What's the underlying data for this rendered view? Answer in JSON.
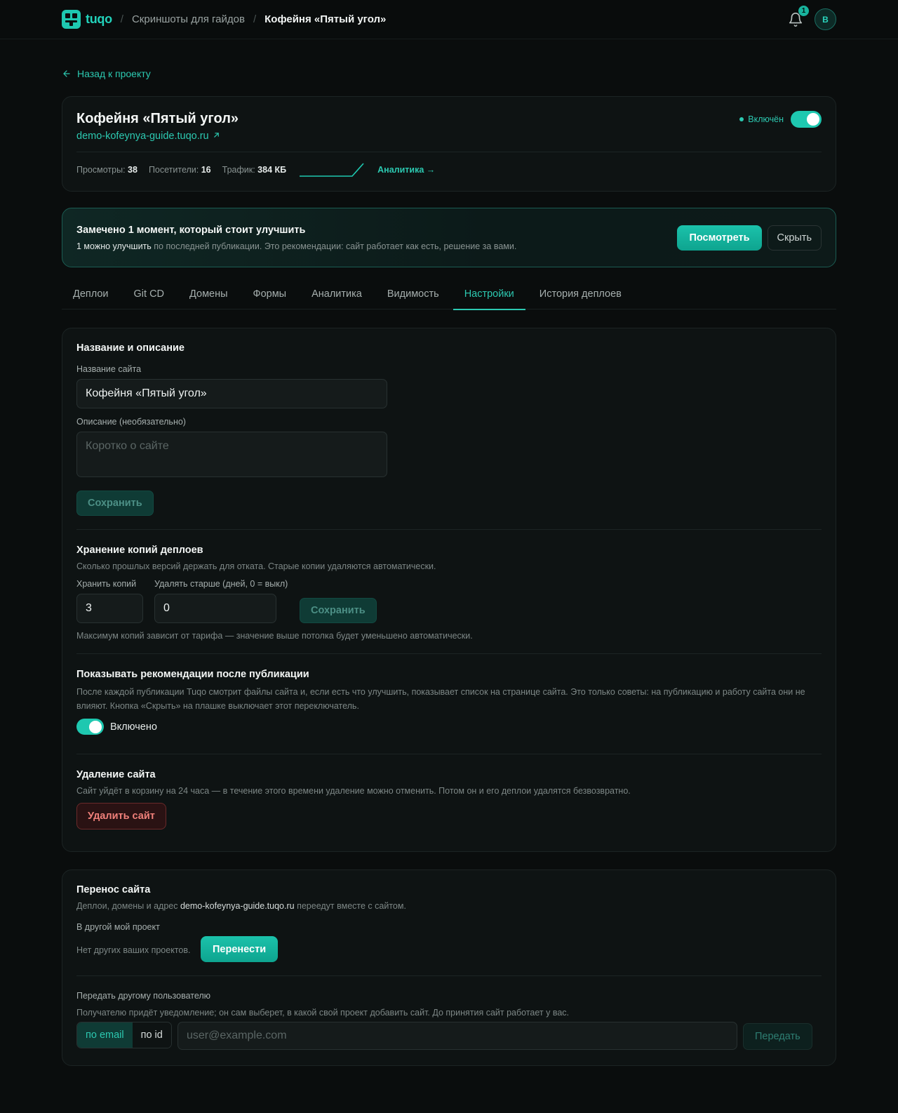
{
  "header": {
    "logo_text": "tuqo",
    "breadcrumb": [
      "Скриншоты для гайдов",
      "Кофейня «Пятый угол»"
    ],
    "notification_count": "1",
    "avatar_initial": "В"
  },
  "back_link": "Назад к проекту",
  "site": {
    "title": "Кофейня «Пятый угол»",
    "url": "demo-kofeynya-guide.tuqo.ru",
    "status": "Включён",
    "enabled": true,
    "stats": [
      {
        "label": "Просмотры:",
        "value": "38"
      },
      {
        "label": "Посетители:",
        "value": "16"
      },
      {
        "label": "Трафик:",
        "value": "384 КБ"
      }
    ],
    "analytics_link": "Аналитика →"
  },
  "banner": {
    "title": "Замечено 1 момент, который стоит улучшить",
    "sub_bold": "1 можно улучшить",
    "sub_rest": " по последней публикации. Это рекомендации: сайт работает как есть, решение за вами.",
    "view_button": "Посмотреть",
    "hide_button": "Скрыть"
  },
  "tabs": [
    {
      "label": "Деплои",
      "active": false
    },
    {
      "label": "Git CD",
      "active": false
    },
    {
      "label": "Домены",
      "active": false
    },
    {
      "label": "Формы",
      "active": false
    },
    {
      "label": "Аналитика",
      "active": false
    },
    {
      "label": "Видимость",
      "active": false
    },
    {
      "label": "Настройки",
      "active": true
    },
    {
      "label": "История деплоев",
      "active": false
    }
  ],
  "settings": {
    "name_section": {
      "title": "Название и описание",
      "name_label": "Название сайта",
      "name_value": "Кофейня «Пятый угол»",
      "desc_label": "Описание (необязательно)",
      "desc_placeholder": "Коротко о сайте",
      "save": "Сохранить"
    },
    "retention": {
      "title": "Хранение копий деплоев",
      "desc": "Сколько прошлых версий держать для отката. Старые копии удаляются автоматически.",
      "keep_label": "Хранить копий",
      "keep_value": "3",
      "older_label": "Удалять старше (дней, 0 = выкл)",
      "older_value": "0",
      "save": "Сохранить",
      "note": "Максимум копий зависит от тарифа — значение выше потолка будет уменьшено автоматически."
    },
    "recommendations": {
      "title": "Показывать рекомендации после публикации",
      "desc": "После каждой публикации Tuqo смотрит файлы сайта и, если есть что улучшить, показывает список на странице сайта. Это только советы: на публикацию и работу сайта они не влияют. Кнопка «Скрыть» на плашке выключает этот переключатель.",
      "toggle_label": "Включено",
      "enabled": true
    },
    "delete": {
      "title": "Удаление сайта",
      "desc": "Сайт уйдёт в корзину на 24 часа — в течение этого времени удаление можно отменить. Потом он и его деплои удалятся безвозвратно.",
      "button": "Удалить сайт"
    }
  },
  "transfer": {
    "title": "Перенос сайта",
    "desc_pre": "Деплои, домены и адрес ",
    "desc_url": "demo-kofeynya-guide.tuqo.ru",
    "desc_post": " переедут вместе с сайтом.",
    "own_label": "В другой мой проект",
    "own_empty": "Нет других ваших проектов.",
    "move_button": "Перенести",
    "user_label": "Передать другому пользователю",
    "user_desc": "Получателю придёт уведомление; он сам выберет, в какой свой проект добавить сайт. До принятия сайт работает у вас.",
    "mode_email": "по email",
    "mode_id": "по id",
    "email_placeholder": "user@example.com",
    "send_button": "Передать"
  },
  "colors": {
    "accent": "#1ec8b0",
    "background": "#0a0d0d",
    "card": "#0e1313",
    "danger": "#f0807a"
  }
}
